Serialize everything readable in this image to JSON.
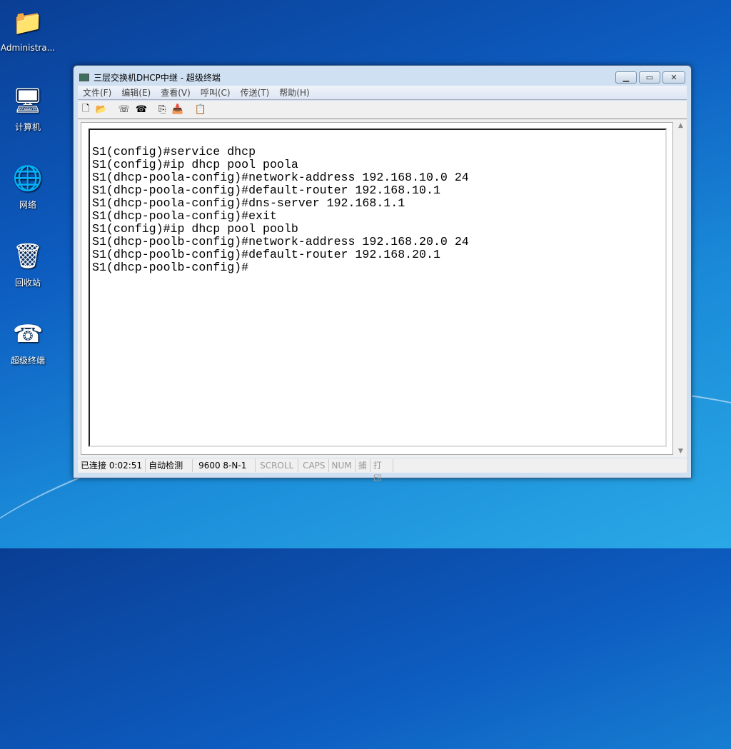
{
  "desktop": {
    "icons": [
      {
        "label": "Administra...",
        "icon": "user-folder-icon",
        "glyph": "📁"
      },
      {
        "label": "计算机",
        "icon": "computer-icon",
        "glyph": "🖥"
      },
      {
        "label": "网络",
        "icon": "network-icon",
        "glyph": "🌐"
      },
      {
        "label": "回收站",
        "icon": "recycle-bin-icon",
        "glyph": "🗑"
      },
      {
        "label": "超级终端",
        "icon": "hyperterminal-icon",
        "glyph": "☎"
      }
    ]
  },
  "window": {
    "title": "三层交换机DHCP中继 - 超级终端",
    "controls": {
      "minimize": "▁",
      "maximize": "▭",
      "close": "✕"
    },
    "menu": [
      "文件(F)",
      "编辑(E)",
      "查看(V)",
      "呼叫(C)",
      "传送(T)",
      "帮助(H)"
    ],
    "toolbar": [
      {
        "name": "new-icon",
        "glyph": "🗋"
      },
      {
        "name": "open-icon",
        "glyph": "📂"
      },
      {
        "name": "disconnect-icon",
        "glyph": "☏"
      },
      {
        "name": "call-icon",
        "glyph": "☎"
      },
      {
        "name": "send-icon",
        "glyph": "⎘"
      },
      {
        "name": "receive-icon",
        "glyph": "📥"
      },
      {
        "name": "properties-icon",
        "glyph": "📋"
      }
    ],
    "terminal_lines": [
      "S1(config)#service dhcp",
      "S1(config)#ip dhcp pool poola",
      "S1(dhcp-poola-config)#network-address 192.168.10.0 24",
      "S1(dhcp-poola-config)#default-router 192.168.10.1",
      "S1(dhcp-poola-config)#dns-server 192.168.1.1",
      "S1(dhcp-poola-config)#exit",
      "S1(config)#ip dhcp pool poolb",
      "S1(dhcp-poolb-config)#network-address 192.168.20.0 24",
      "S1(dhcp-poolb-config)#default-router 192.168.20.1",
      "S1(dhcp-poolb-config)#"
    ],
    "status": {
      "connected": "已连接 0:02:51",
      "detect": "自动检测",
      "port": "9600 8-N-1",
      "scroll": "SCROLL",
      "caps": "CAPS",
      "num": "NUM",
      "capture": "捕",
      "print": "打印"
    }
  }
}
